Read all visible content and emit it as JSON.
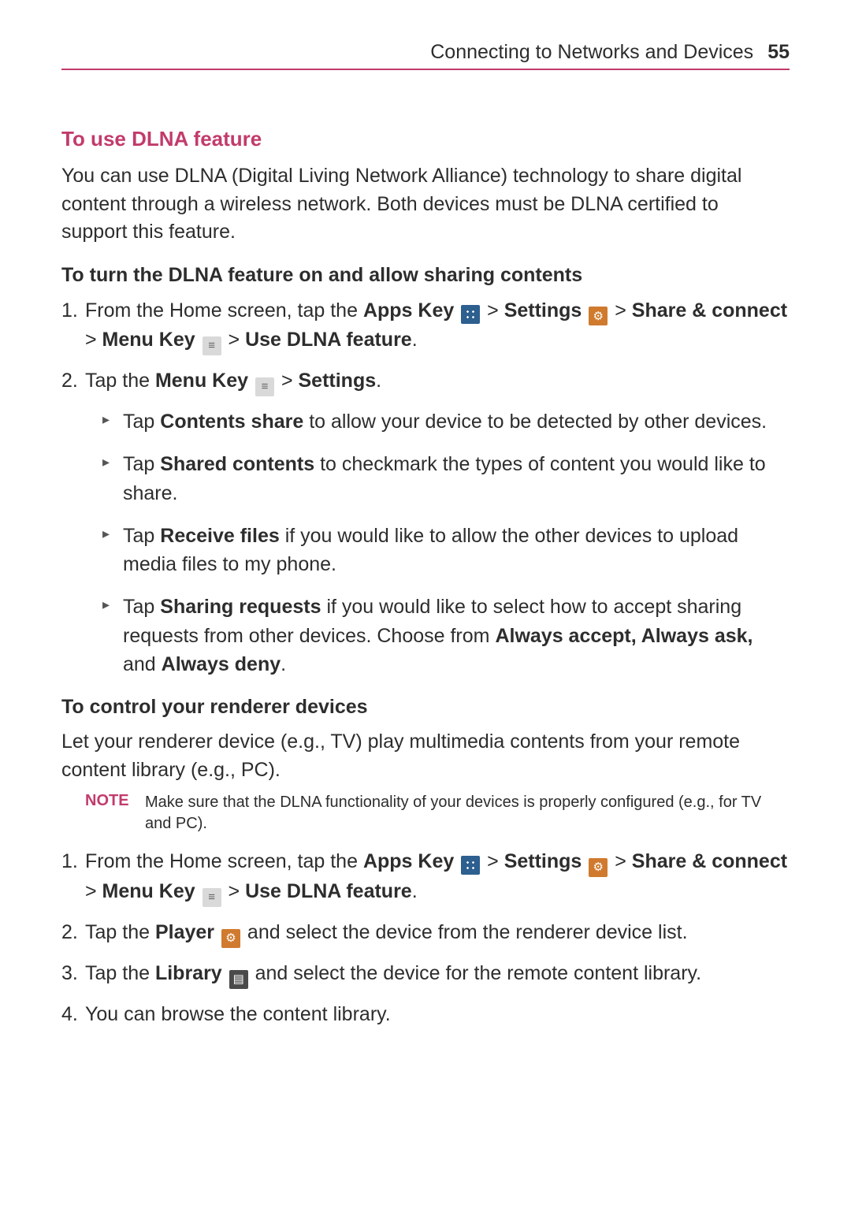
{
  "header": {
    "title": "Connecting to Networks and Devices",
    "page": "55"
  },
  "s1": {
    "heading": "To use DLNA feature",
    "intro": "You can use DLNA (Digital Living Network Alliance) technology to share digital content through a wireless network. Both devices must be DLNA certified to support this feature."
  },
  "s2": {
    "subhead": "To turn the DLNA feature on and allow sharing contents",
    "li1_a": "From the Home screen, tap the ",
    "li1_apps": "Apps Key",
    "li1_b": " > ",
    "li1_settings": "Settings",
    "li1_c": " > ",
    "li1_share": "Share & connect",
    "li1_d": " > ",
    "li1_menu": "Menu Key",
    "li1_e": " > ",
    "li1_dlna": "Use DLNA feature",
    "li1_period": ".",
    "li2_a": "Tap the ",
    "li2_menu": "Menu Key",
    "li2_b": " > ",
    "li2_settings": "Settings",
    "li2_period": ".",
    "b1_a": "Tap ",
    "b1_bold": "Contents share",
    "b1_b": " to allow your device to be detected by other devices.",
    "b2_a": "Tap ",
    "b2_bold": "Shared contents",
    "b2_b": " to checkmark the types of content you would like to share.",
    "b3_a": "Tap ",
    "b3_bold": "Receive files",
    "b3_b": " if you would like to allow the other devices to upload media files to my phone.",
    "b4_a": "Tap ",
    "b4_bold": "Sharing requests",
    "b4_b": " if you would like to select how to accept sharing requests from other devices. Choose from ",
    "b4_opt1": "Always accept, Always ask,",
    "b4_c": " and ",
    "b4_opt2": "Always deny",
    "b4_period": "."
  },
  "s3": {
    "subhead": "To control your renderer devices",
    "intro": "Let your renderer device (e.g., TV) play multimedia contents from your remote content library (e.g., PC).",
    "note_label": "NOTE",
    "note_text": "Make sure that the DLNA functionality of your devices is properly configured (e.g., for TV and PC).",
    "li1_a": "From the Home screen, tap the ",
    "li1_apps": "Apps Key",
    "li1_b": " > ",
    "li1_settings": "Settings",
    "li1_c": " > ",
    "li1_share": "Share & connect",
    "li1_d": " > ",
    "li1_menu": "Menu Key",
    "li1_e": " > ",
    "li1_dlna": "Use DLNA feature",
    "li1_period": ".",
    "li2_a": "Tap the ",
    "li2_player": "Player",
    "li2_b": " and select the device from the renderer device list.",
    "li3_a": "Tap the ",
    "li3_library": "Library",
    "li3_b": " and select the device for the remote content library.",
    "li4": "You can browse the content library."
  }
}
